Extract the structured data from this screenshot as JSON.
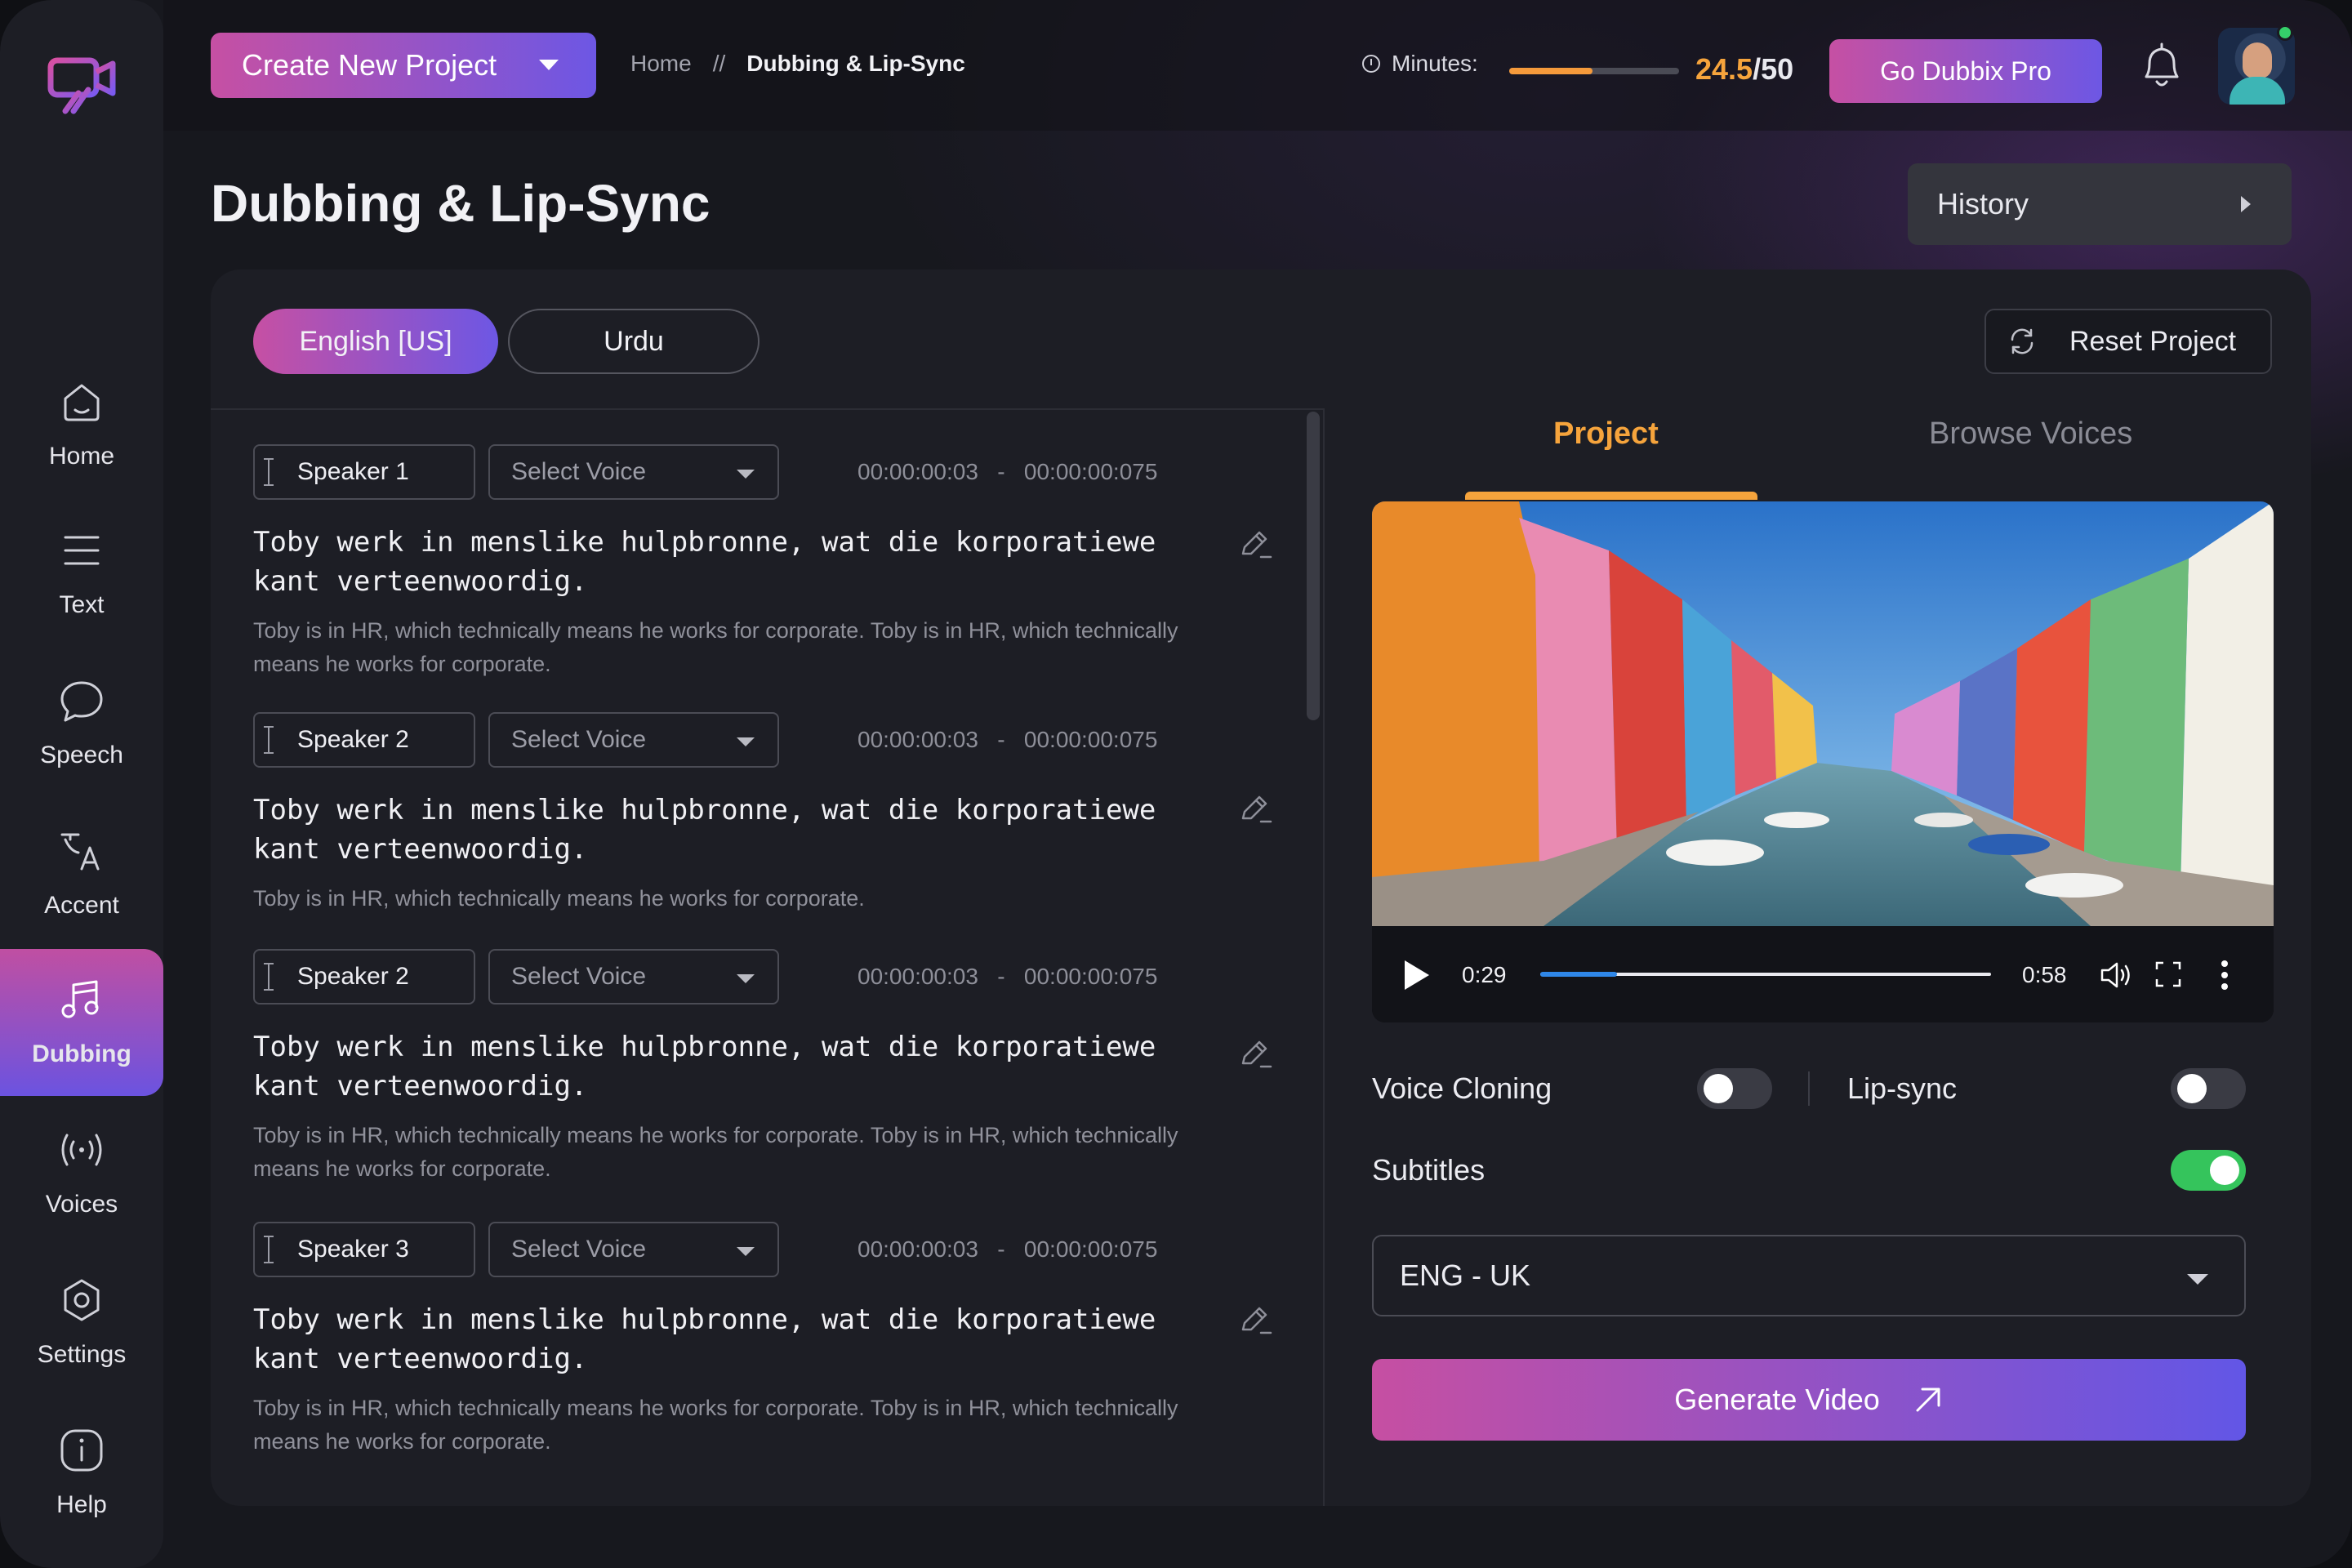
{
  "sidebar": {
    "items": [
      {
        "label": "Home",
        "icon": "home-icon"
      },
      {
        "label": "Text",
        "icon": "text-lines-icon"
      },
      {
        "label": "Speech",
        "icon": "speech-bubble-icon"
      },
      {
        "label": "Accent",
        "icon": "translate-icon"
      },
      {
        "label": "Dubbing",
        "icon": "music-note-icon",
        "active": true
      },
      {
        "label": "Voices",
        "icon": "broadcast-icon"
      },
      {
        "label": "Settings",
        "icon": "gear-icon"
      },
      {
        "label": "Help",
        "icon": "info-icon"
      }
    ]
  },
  "header": {
    "create_label": "Create New Project",
    "breadcrumb": {
      "home": "Home",
      "sep": "//",
      "current": "Dubbing & Lip-Sync"
    },
    "minutes_label": "Minutes:",
    "minutes_used": "24.5",
    "minutes_total": "/50",
    "minutes_fraction": 0.49,
    "pro_label": "Go Dubbix Pro"
  },
  "page": {
    "title": "Dubbing & Lip-Sync",
    "history_label": "History"
  },
  "languages": {
    "primary": "English [US]",
    "secondary": "Urdu"
  },
  "reset_label": "Reset Project",
  "segments": [
    {
      "speaker": "Speaker 1",
      "voice_placeholder": "Select Voice",
      "time": "00:00:00:03   -   00:00:00:075",
      "text": "Toby werk in menslike hulpbronne, wat die korporatiewe kant verteenwoordig.",
      "translation": "Toby is in HR, which technically means he works for corporate. Toby is in HR, which technically means he works for corporate."
    },
    {
      "speaker": "Speaker 2",
      "voice_placeholder": "Select Voice",
      "time": "00:00:00:03   -   00:00:00:075",
      "text": "Toby werk in menslike hulpbronne, wat die korporatiewe kant verteenwoordig.",
      "translation": "Toby is in HR, which technically means he works for corporate."
    },
    {
      "speaker": "Speaker 2",
      "voice_placeholder": "Select Voice",
      "time": "00:00:00:03   -   00:00:00:075",
      "text": "Toby werk in menslike hulpbronne, wat die korporatiewe kant verteenwoordig.",
      "translation": "Toby is in HR, which technically means he works for corporate. Toby is in HR, which technically means he works for corporate."
    },
    {
      "speaker": "Speaker 3",
      "voice_placeholder": "Select Voice",
      "time": "00:00:00:03   -   00:00:00:075",
      "text": "Toby werk in menslike hulpbronne, wat die korporatiewe kant verteenwoordig.",
      "translation": "Toby is in HR, which technically means he works for corporate. Toby is in HR, which technically means he works for corporate."
    }
  ],
  "panel": {
    "tab_project": "Project",
    "tab_browse": "Browse Voices",
    "video": {
      "current": "0:29",
      "total": "0:58",
      "progress": 0.17
    },
    "voice_cloning_label": "Voice Cloning",
    "voice_cloning_on": false,
    "lipsync_label": "Lip-sync",
    "lipsync_on": false,
    "subtitles_label": "Subtitles",
    "subtitles_on": true,
    "subtitle_language": "ENG - UK",
    "generate_label": "Generate Video"
  },
  "colors": {
    "accent_orange": "#f6a43c",
    "gradient_start": "#c650a3",
    "gradient_end": "#6d57e4",
    "toggle_on": "#35c45c",
    "progress_blue": "#2f87e8"
  }
}
